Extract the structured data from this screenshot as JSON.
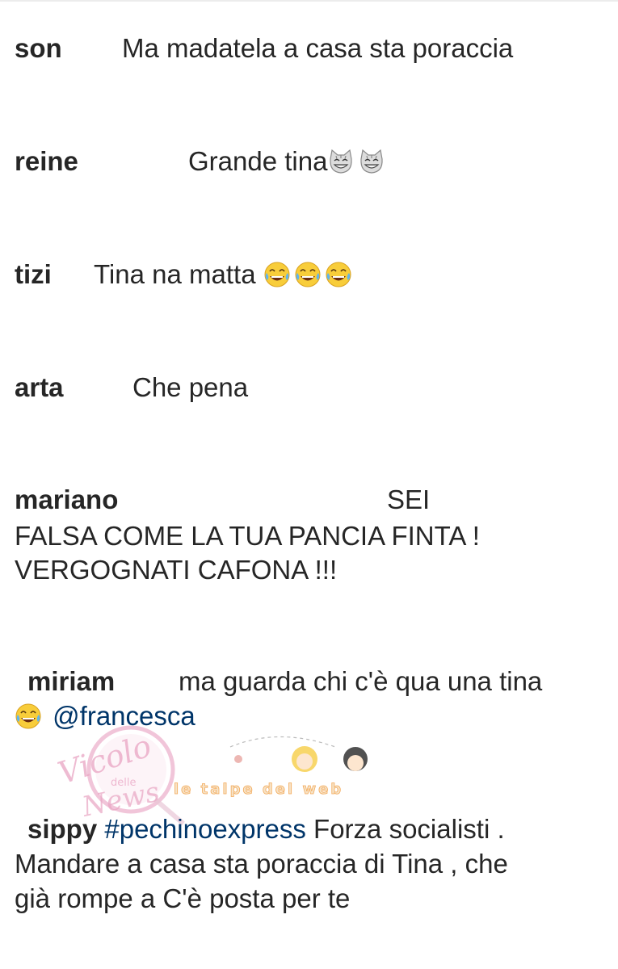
{
  "comments": [
    {
      "user": "son",
      "text": "Ma madatela a casa sta poraccia"
    },
    {
      "user": "reine",
      "text": "Grande tina",
      "emoji": [
        "grinning-cat-icon",
        "grinning-cat-icon"
      ]
    },
    {
      "user": "tizi",
      "text": "Tina na matta",
      "emoji": [
        "tears-of-joy-icon",
        "tears-of-joy-icon",
        "tears-of-joy-icon"
      ]
    },
    {
      "user": "arta",
      "text": "Che pena"
    },
    {
      "user": "mariano",
      "text_line1": "SEI",
      "text_line2": "FALSA COME LA TUA PANCIA FINTA !",
      "text_line3": "VERGOGNATI CAFONA !!!"
    },
    {
      "user": "miriam",
      "text": "ma guarda chi c'è qua una tina",
      "mention": "@francesca",
      "emoji": [
        "tears-of-joy-icon"
      ]
    },
    {
      "user": "sippy",
      "hashtag": "#pechinoexpress",
      "text_line1": "Forza socialisti .",
      "text_line2": "Mandare a casa sta poraccia di Tina , che",
      "text_line3": "già rompe a C'è posta per te"
    }
  ],
  "watermarks": {
    "left_line1": "Vicolo",
    "left_line2": "delle",
    "left_line3": "News",
    "right": "le talpe del web"
  },
  "colors": {
    "text": "#262626",
    "link": "#003569",
    "watermark_pink": "#e8a7c4",
    "watermark_orange": "#f2a24a"
  }
}
